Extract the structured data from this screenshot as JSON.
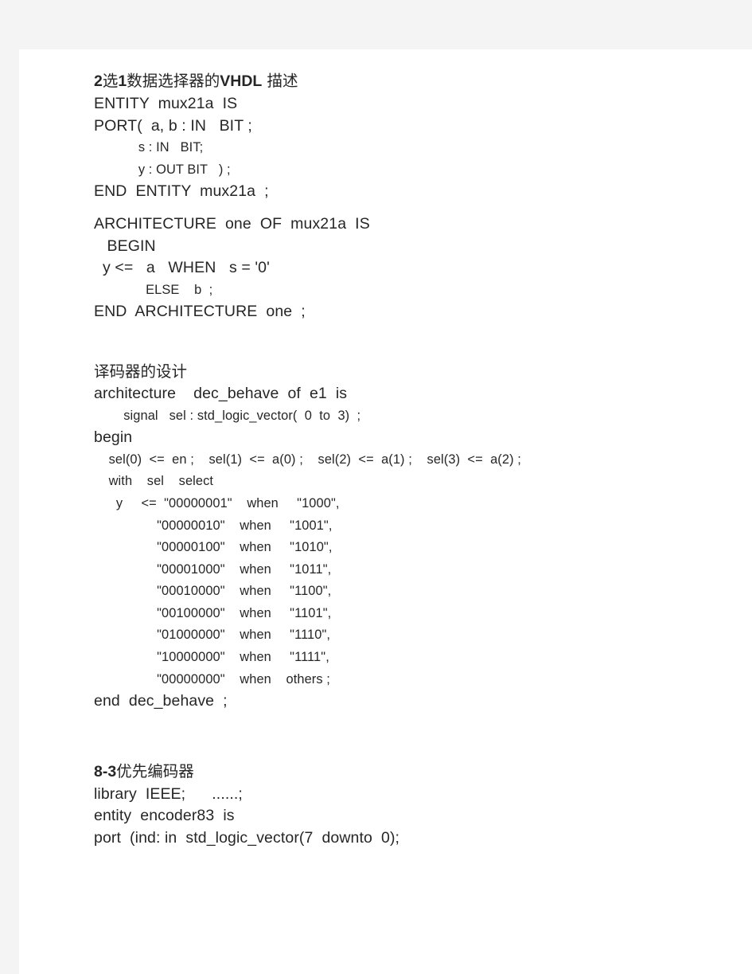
{
  "document": {
    "page_background": "#ffffff",
    "gutter_color": "#f4f4f4",
    "text_color": "#262626"
  },
  "sections": [
    {
      "id": "mux21a",
      "heading": {
        "latin_1": "2",
        "cjk_1": "选",
        "latin_2": "1",
        "cjk_2": "数据选择器的",
        "latin_3": "VHDL",
        "cjk_3": " 描述"
      },
      "lines": [
        {
          "text": "ENTITY  mux21a  IS",
          "size": "normal"
        },
        {
          "text": "PORT(  a, b : IN   BIT ;",
          "size": "normal"
        },
        {
          "text": "            s : IN   BIT;",
          "size": "small"
        },
        {
          "text": "            y : OUT BIT   ) ;",
          "size": "small"
        },
        {
          "text": "END  ENTITY  mux21a  ;",
          "size": "normal"
        },
        {
          "text": "",
          "size": "normal"
        },
        {
          "text": "ARCHITECTURE  one  OF  mux21a  IS",
          "size": "normal"
        },
        {
          "text": "   BEGIN",
          "size": "normal"
        },
        {
          "text": "  y <=   a   WHEN   s = '0'",
          "size": "normal"
        },
        {
          "text": "              ELSE    b  ;",
          "size": "small"
        },
        {
          "text": "END  ARCHITECTURE  one  ;",
          "size": "normal"
        }
      ]
    },
    {
      "id": "decoder",
      "heading_plain": "译码器的设计",
      "lines": [
        {
          "text": "architecture    dec_behave  of  e1  is",
          "size": "normal"
        },
        {
          "text": "        signal   sel : std_logic_vector(  0  to  3)  ;",
          "size": "small"
        },
        {
          "text": "begin",
          "size": "normal"
        },
        {
          "text": "    sel(0)  <=  en ;    sel(1)  <=  a(0) ;    sel(2)  <=  a(1) ;    sel(3)  <=  a(2) ;",
          "size": "small"
        },
        {
          "text": "    with    sel    select",
          "size": "small"
        },
        {
          "text": "      y     <=  \"00000001\"    when     \"1000\",",
          "size": "small"
        },
        {
          "text": "                 \"00000010\"    when     \"1001\",",
          "size": "small"
        },
        {
          "text": "                 \"00000100\"    when     \"1010\",",
          "size": "small"
        },
        {
          "text": "                 \"00001000\"    when     \"1011\",",
          "size": "small"
        },
        {
          "text": "                 \"00010000\"    when     \"1100\",",
          "size": "small"
        },
        {
          "text": "                 \"00100000\"    when     \"1101\",",
          "size": "small"
        },
        {
          "text": "                 \"01000000\"    when     \"1110\",",
          "size": "small"
        },
        {
          "text": "                 \"10000000\"    when     \"1111\",",
          "size": "small"
        },
        {
          "text": "                 \"00000000\"    when    others ;",
          "size": "small"
        },
        {
          "text": "end  dec_behave  ;",
          "size": "normal"
        }
      ]
    },
    {
      "id": "encoder83",
      "heading": {
        "latin_1": "8-3",
        "cjk_1": "优先编码器",
        "latin_2": "",
        "cjk_2": "",
        "latin_3": "",
        "cjk_3": ""
      },
      "lines": [
        {
          "text": "library  IEEE;      ......;",
          "size": "normal"
        },
        {
          "text": "entity  encoder83  is",
          "size": "normal"
        },
        {
          "text": "port  (ind: in  std_logic_vector(7  downto  0);",
          "size": "normal"
        }
      ]
    }
  ]
}
